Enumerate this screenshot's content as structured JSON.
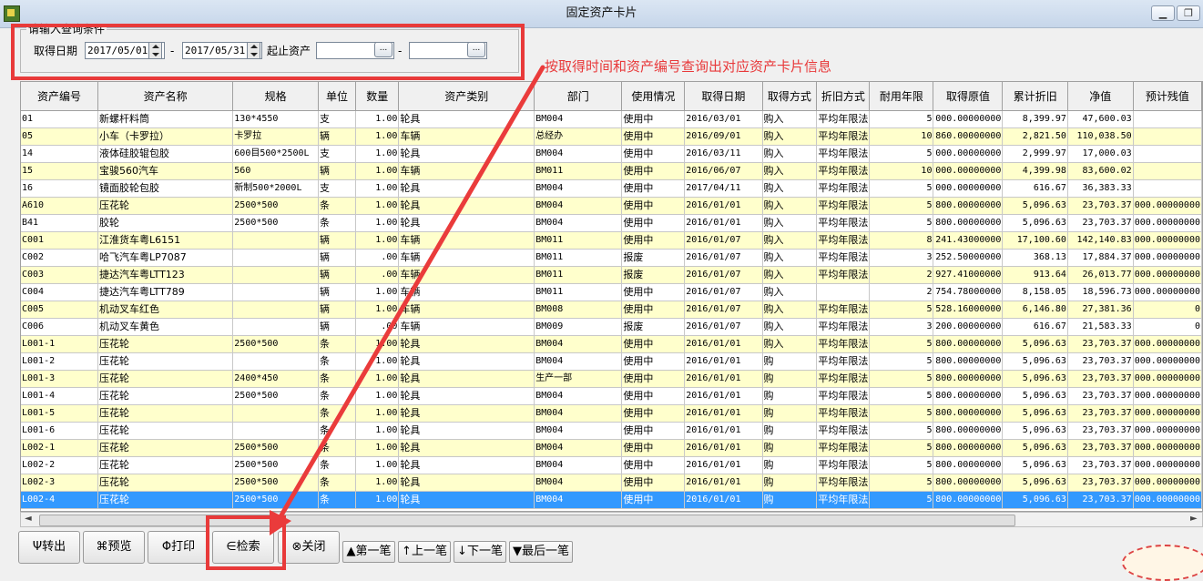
{
  "window": {
    "title": "固定资产卡片",
    "minimize": "▁",
    "restore": "❐"
  },
  "query": {
    "legend": "请输入查询条件",
    "date_label": "取得日期",
    "date_from": "2017/05/01",
    "date_sep": "-",
    "date_to": "2017/05/31",
    "asset_label": "起止资产",
    "asset_from": "",
    "asset_sep": "-",
    "asset_to": "",
    "browse": "..."
  },
  "annotation": "按取得时间和资产编号查询出对应资产卡片信息",
  "table": {
    "columns": [
      "资产编号",
      "资产名称",
      "规格",
      "单位",
      "数量",
      "资产类别",
      "部门",
      "使用情况",
      "取得日期",
      "取得方式",
      "折旧方式",
      "耐用年限",
      "取得原值",
      "累计折旧",
      "净值",
      "预计残值"
    ],
    "rows": [
      [
        "01",
        "新螺杆料筒",
        "130*4550",
        "支",
        "1.00",
        "轮具",
        "BM004",
        "使用中",
        "2016/03/01",
        "购入",
        "平均年限法",
        "5",
        "000.00000000",
        "8,399.97",
        "47,600.03",
        ""
      ],
      [
        "05",
        "小车（卡罗拉）",
        "卡罗拉",
        "辆",
        "1.00",
        "车辆",
        "总经办",
        "使用中",
        "2016/09/01",
        "购入",
        "平均年限法",
        "10",
        "860.00000000",
        "2,821.50",
        "110,038.50",
        ""
      ],
      [
        "14",
        "液体硅胶辊包胶",
        "600目500*2500L",
        "支",
        "1.00",
        "轮具",
        "BM004",
        "使用中",
        "2016/03/11",
        "购入",
        "平均年限法",
        "5",
        "000.00000000",
        "2,999.97",
        "17,000.03",
        ""
      ],
      [
        "15",
        "宝骏560汽车",
        "560",
        "辆",
        "1.00",
        "车辆",
        "BM011",
        "使用中",
        "2016/06/07",
        "购入",
        "平均年限法",
        "10",
        "000.00000000",
        "4,399.98",
        "83,600.02",
        ""
      ],
      [
        "16",
        "镜面胶轮包胶",
        "新制500*2000L",
        "支",
        "1.00",
        "轮具",
        "BM004",
        "使用中",
        "2017/04/11",
        "购入",
        "平均年限法",
        "5",
        "000.00000000",
        "616.67",
        "36,383.33",
        ""
      ],
      [
        "A610",
        "压花轮",
        "2500*500",
        "条",
        "1.00",
        "轮具",
        "BM004",
        "使用中",
        "2016/01/01",
        "购入",
        "平均年限法",
        "5",
        "800.00000000",
        "5,096.63",
        "23,703.37",
        "000.00000000"
      ],
      [
        "B41",
        "胶轮",
        "2500*500",
        "条",
        "1.00",
        "轮具",
        "BM004",
        "使用中",
        "2016/01/01",
        "购入",
        "平均年限法",
        "5",
        "800.00000000",
        "5,096.63",
        "23,703.37",
        "000.00000000"
      ],
      [
        "C001",
        "江淮货车粤L6151",
        "",
        "辆",
        "1.00",
        "车辆",
        "BM011",
        "使用中",
        "2016/01/07",
        "购入",
        "平均年限法",
        "8",
        "241.43000000",
        "17,100.60",
        "142,140.83",
        "000.00000000"
      ],
      [
        "C002",
        "哈飞汽车粤LP7087",
        "",
        "辆",
        ".00",
        "车辆",
        "BM011",
        "报废",
        "2016/01/07",
        "购入",
        "平均年限法",
        "3",
        "252.50000000",
        "368.13",
        "17,884.37",
        "000.00000000"
      ],
      [
        "C003",
        "捷达汽车粤LTT123",
        "",
        "辆",
        ".00",
        "车辆",
        "BM011",
        "报废",
        "2016/01/07",
        "购入",
        "平均年限法",
        "2",
        "927.41000000",
        "913.64",
        "26,013.77",
        "000.00000000"
      ],
      [
        "C004",
        "捷达汽车粤LTT789",
        "",
        "辆",
        "1.00",
        "车辆",
        "BM011",
        "使用中",
        "2016/01/07",
        "购入",
        "",
        "2",
        "754.78000000",
        "8,158.05",
        "18,596.73",
        "000.00000000"
      ],
      [
        "C005",
        "机动叉车红色",
        "",
        "辆",
        "1.00",
        "车辆",
        "BM008",
        "使用中",
        "2016/01/07",
        "购入",
        "平均年限法",
        "5",
        "528.16000000",
        "6,146.80",
        "27,381.36",
        "0"
      ],
      [
        "C006",
        "机动叉车黄色",
        "",
        "辆",
        ".00",
        "车辆",
        "BM009",
        "报废",
        "2016/01/07",
        "购入",
        "平均年限法",
        "3",
        "200.00000000",
        "616.67",
        "21,583.33",
        "0"
      ],
      [
        "L001-1",
        "压花轮",
        "2500*500",
        "条",
        "1.00",
        "轮具",
        "BM004",
        "使用中",
        "2016/01/01",
        "购入",
        "平均年限法",
        "5",
        "800.00000000",
        "5,096.63",
        "23,703.37",
        "000.00000000"
      ],
      [
        "L001-2",
        "压花轮",
        "",
        "条",
        "1.00",
        "轮具",
        "BM004",
        "使用中",
        "2016/01/01",
        "购",
        "平均年限法",
        "5",
        "800.00000000",
        "5,096.63",
        "23,703.37",
        "000.00000000"
      ],
      [
        "L001-3",
        "压花轮",
        "2400*450",
        "条",
        "1.00",
        "轮具",
        "生产一部",
        "使用中",
        "2016/01/01",
        "购",
        "平均年限法",
        "5",
        "800.00000000",
        "5,096.63",
        "23,703.37",
        "000.00000000"
      ],
      [
        "L001-4",
        "压花轮",
        "2500*500",
        "条",
        "1.00",
        "轮具",
        "BM004",
        "使用中",
        "2016/01/01",
        "购",
        "平均年限法",
        "5",
        "800.00000000",
        "5,096.63",
        "23,703.37",
        "000.00000000"
      ],
      [
        "L001-5",
        "压花轮",
        "",
        "条",
        "1.00",
        "轮具",
        "BM004",
        "使用中",
        "2016/01/01",
        "购",
        "平均年限法",
        "5",
        "800.00000000",
        "5,096.63",
        "23,703.37",
        "000.00000000"
      ],
      [
        "L001-6",
        "压花轮",
        "",
        "条",
        "1.00",
        "轮具",
        "BM004",
        "使用中",
        "2016/01/01",
        "购",
        "平均年限法",
        "5",
        "800.00000000",
        "5,096.63",
        "23,703.37",
        "000.00000000"
      ],
      [
        "L002-1",
        "压花轮",
        "2500*500",
        "条",
        "1.00",
        "轮具",
        "BM004",
        "使用中",
        "2016/01/01",
        "购",
        "平均年限法",
        "5",
        "800.00000000",
        "5,096.63",
        "23,703.37",
        "000.00000000"
      ],
      [
        "L002-2",
        "压花轮",
        "2500*500",
        "条",
        "1.00",
        "轮具",
        "BM004",
        "使用中",
        "2016/01/01",
        "购",
        "平均年限法",
        "5",
        "800.00000000",
        "5,096.63",
        "23,703.37",
        "000.00000000"
      ],
      [
        "L002-3",
        "压花轮",
        "2500*500",
        "条",
        "1.00",
        "轮具",
        "BM004",
        "使用中",
        "2016/01/01",
        "购",
        "平均年限法",
        "5",
        "800.00000000",
        "5,096.63",
        "23,703.37",
        "000.00000000"
      ],
      [
        "L002-4",
        "压花轮",
        "2500*500",
        "条",
        "1.00",
        "轮具",
        "BM004",
        "使用中",
        "2016/01/01",
        "购",
        "平均年限法",
        "5",
        "800.00000000",
        "5,096.63",
        "23,703.37",
        "000.00000000"
      ]
    ]
  },
  "toolbar": {
    "export": "转出",
    "preview": "预览",
    "print": "打印",
    "search": "检索",
    "close": "关闭",
    "first": "第一笔",
    "prev": "上一笔",
    "next": "下一笔",
    "last": "最后一笔"
  },
  "scroll": {
    "left": "◄",
    "right": "►"
  }
}
